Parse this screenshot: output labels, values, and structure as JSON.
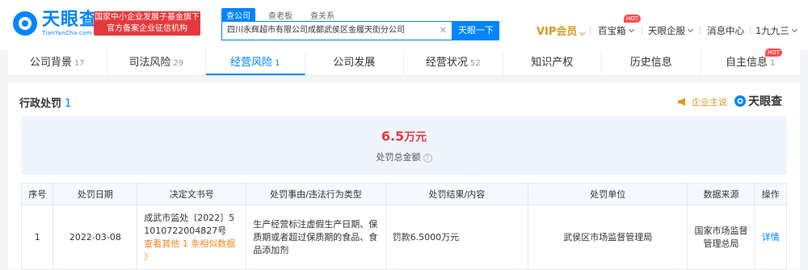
{
  "header": {
    "logo_cn": "天眼查",
    "logo_en": "TianYanCha.com",
    "gov_badge_line1": "国家中小企业发展子基金旗下",
    "gov_badge_line2": "官方备案企业征信机构",
    "search_tabs": [
      "查公司",
      "查老板",
      "查关系"
    ],
    "search_value": "四川永辉超市有限公司成都武侯区金履天街分公司",
    "search_button": "天眼一下",
    "vip_label": "VIP会员",
    "baibao_label": "百宝箱",
    "hot_badge": "HOT",
    "enterprise_label": "天眼企服",
    "message_label": "消息中心",
    "user_label": "1九九三"
  },
  "tabs": [
    {
      "label": "公司背景",
      "count": "17"
    },
    {
      "label": "司法风险",
      "count": "29"
    },
    {
      "label": "经营风险",
      "count": "1"
    },
    {
      "label": "公司发展",
      "count": ""
    },
    {
      "label": "经营状况",
      "count": "52"
    },
    {
      "label": "知识产权",
      "count": ""
    },
    {
      "label": "历史信息",
      "count": ""
    },
    {
      "label": "自主信息",
      "count": "1",
      "hot": "HOT"
    }
  ],
  "panel": {
    "title": "行政处罚",
    "count": "1",
    "owner_say": "企业主说",
    "brand": "天眼查",
    "summary_amount": "6.5",
    "summary_unit": "万元",
    "summary_label": "处罚总金额"
  },
  "table": {
    "headers": [
      "序号",
      "处罚日期",
      "决定文书号",
      "处罚事由/违法行为类型",
      "处罚结果/内容",
      "处罚单位",
      "数据来源",
      "操作"
    ],
    "rows": [
      {
        "index": "1",
        "date": "2022-03-08",
        "doc_no": "成武市监处〔2022〕51010722004827号",
        "doc_more": "查看其他 1 条相似数据 〉",
        "reason": "生产经营标注虚假生产日期、保质期或者超过保质期的食品、食品添加剂",
        "result": "罚款6.5000万元",
        "unit": "武侯区市场监督管理局",
        "source": "国家市场监督管理总局",
        "action": "详情"
      }
    ]
  },
  "colors": {
    "brand_blue": "#0084ff",
    "danger_red": "#e4393c",
    "vip_gold": "#d69a23"
  }
}
